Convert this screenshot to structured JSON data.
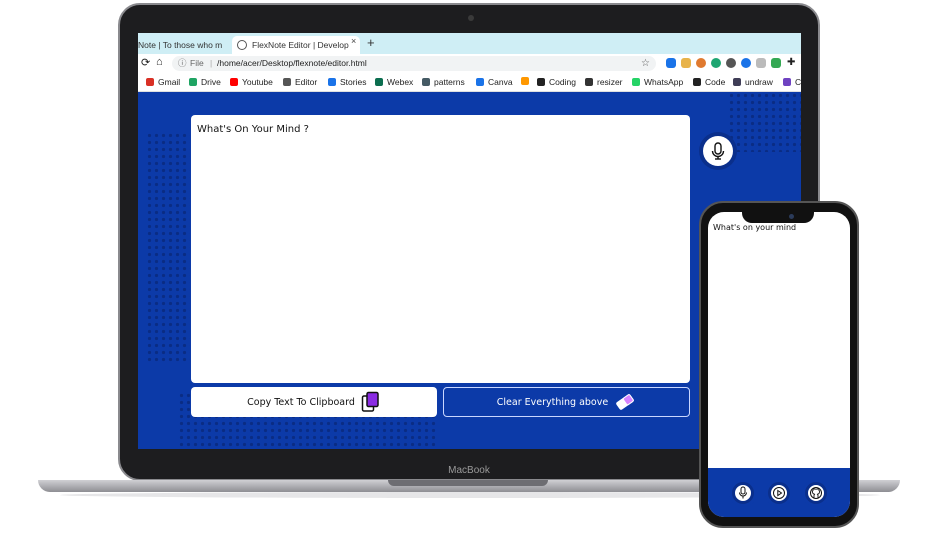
{
  "laptop": {
    "brand": "MacBook",
    "browser": {
      "tabs": [
        {
          "label": "Note | To those who m"
        },
        {
          "label": "FlexNote Editor | Develop",
          "close": "×"
        }
      ],
      "new_tab": "+",
      "address": {
        "info": "ⓘ",
        "scheme": "File",
        "separator": "|",
        "url": "/home/acer/Desktop/flexnote/editor.html",
        "star": "☆"
      },
      "bookmarks": [
        {
          "label": "Gmail",
          "color": "#d93025"
        },
        {
          "label": "Drive",
          "color": "#1fa463"
        },
        {
          "label": "Youtube",
          "color": "#ff0000"
        },
        {
          "label": "Editor",
          "color": "#555555"
        },
        {
          "label": "Stories",
          "color": "#1a73e8"
        },
        {
          "label": "Webex",
          "color": "#0b6e4f"
        },
        {
          "label": "patterns",
          "color": "#455a64"
        },
        {
          "label": "Canva",
          "color": "#1a73e8"
        },
        {
          "label": "",
          "color": "#ff9800"
        },
        {
          "label": "Coding",
          "color": "#222222"
        },
        {
          "label": "resizer",
          "color": "#333333"
        },
        {
          "label": "WhatsApp",
          "color": "#25d366"
        },
        {
          "label": "Code",
          "color": "#222222"
        },
        {
          "label": "undraw",
          "color": "#3f3d56"
        },
        {
          "label": "C",
          "color": "#6f42c1"
        }
      ]
    },
    "page": {
      "editor_placeholder": "What's On Your Mind ?",
      "copy_button": "Copy Text To Clipboard",
      "clear_button": "Clear Everything above"
    }
  },
  "phone": {
    "placeholder": "What's on your mind"
  },
  "colors": {
    "brand_blue": "#0c3aa8",
    "dot_blue": "#0a2a80",
    "clipboard_purple": "#8a2be2"
  }
}
